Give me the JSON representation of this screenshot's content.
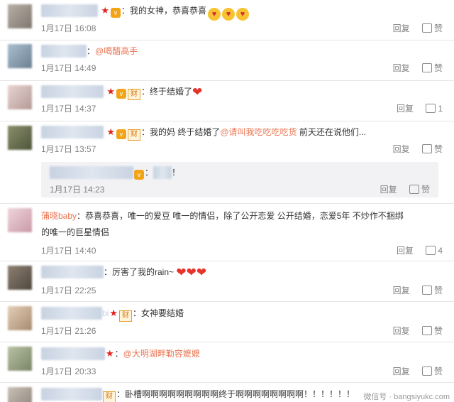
{
  "comments": [
    {
      "badges": [
        "star",
        "v"
      ],
      "text": "：我的女神，恭喜恭喜",
      "emojis": [
        "😍",
        "😍",
        "😍"
      ],
      "time": "1月17日 16:08",
      "reply": "回复",
      "like": "赞"
    },
    {
      "text": "：",
      "mention": "@喝醋高手",
      "time": "1月17日 14:49",
      "reply": "回复",
      "like": "赞"
    },
    {
      "badges": [
        "star",
        "v",
        "cai"
      ],
      "text": "：终于结婚了",
      "time": "1月17日 14:37",
      "reply": "回复",
      "like_count": "1"
    },
    {
      "badges": [
        "star",
        "v",
        "cai"
      ],
      "text_a": "：我的妈 终于结婚了",
      "mention": "@请叫我吃吃吃吃货",
      "text_b": " 前天还在说他们...",
      "time": "1月17日 13:57",
      "reply": "回复",
      "like": "赞"
    },
    {
      "sub": true,
      "text": "：",
      "tail": "！",
      "time": "1月17日 14:23",
      "reply": "回复",
      "like": "赞"
    },
    {
      "name": "蒲晓baby",
      "text": "：恭喜恭喜，唯一的爱豆 唯一的情侣，除了公开恋爱 公开结婚，恋爱5年 不炒作不捆绑",
      "text2": "的唯一的巨星情侣",
      "time": "1月17日 14:40",
      "reply": "回复",
      "like_count": "4"
    },
    {
      "text": "：厉害了我的rain~",
      "time": "1月17日 22:25",
      "reply": "回复",
      "like": "赞"
    },
    {
      "name_tail": "bi",
      "badges": [
        "star",
        "cai"
      ],
      "text": "：女神要结婚",
      "time": "1月17日 21:26",
      "reply": "回复",
      "like": "赞"
    },
    {
      "badges": [
        "star"
      ],
      "text": "：",
      "mention": "@大明湖畔勒容嬷嬷",
      "time": "1月17日 20:33",
      "reply": "回复",
      "like": "赞"
    },
    {
      "badges": [
        "cai"
      ],
      "text": "：卧槽啊啊啊啊啊啊啊啊啊终于啊啊啊啊啊啊啊啊！！！！！！"
    }
  ],
  "footer": "微信号 ·  bangsiyukc.com",
  "icons": {
    "like": "thumbs-up-icon",
    "star": "star-badge-icon",
    "v": "v-badge-icon",
    "cai": "cai-badge-icon"
  },
  "colors": {
    "mention": "#eb7350",
    "time": "#808080",
    "sub_bg": "#f2f2f5"
  }
}
